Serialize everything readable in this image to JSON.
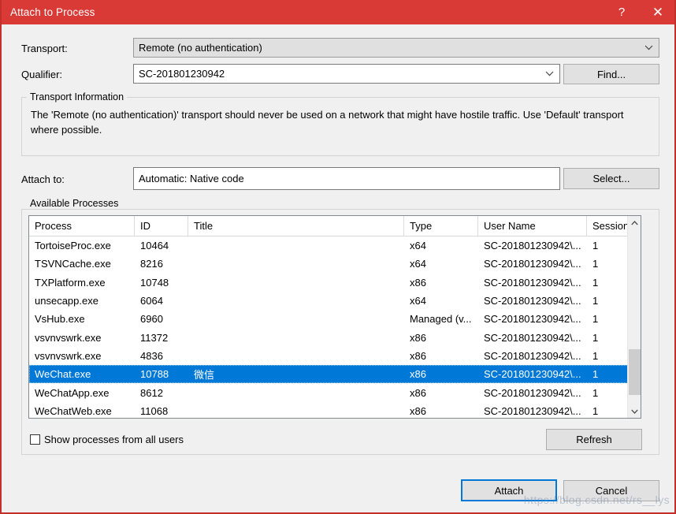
{
  "window": {
    "title": "Attach to Process",
    "help_glyph": "?",
    "close_glyph": "✕",
    "titlebar_color": "#d93a35"
  },
  "form": {
    "transport_label": "Transport:",
    "transport_value": "Remote (no authentication)",
    "qualifier_label": "Qualifier:",
    "qualifier_value": "SC-201801230942",
    "find_button": "Find...",
    "attach_to_label": "Attach to:",
    "attach_to_value": "Automatic: Native code",
    "select_button": "Select..."
  },
  "transport_info": {
    "title": "Transport Information",
    "text": "The 'Remote (no authentication)' transport should never be used on a network that might have hostile traffic. Use 'Default' transport where possible."
  },
  "available_processes": {
    "title": "Available Processes",
    "columns": [
      "Process",
      "ID",
      "Title",
      "Type",
      "User Name",
      "Session"
    ],
    "rows": [
      {
        "process": "TortoiseProc.exe",
        "id": "10464",
        "title": "",
        "type": "x64",
        "user": "SC-201801230942\\...",
        "session": "1",
        "selected": false
      },
      {
        "process": "TSVNCache.exe",
        "id": "8216",
        "title": "",
        "type": "x64",
        "user": "SC-201801230942\\...",
        "session": "1",
        "selected": false
      },
      {
        "process": "TXPlatform.exe",
        "id": "10748",
        "title": "",
        "type": "x86",
        "user": "SC-201801230942\\...",
        "session": "1",
        "selected": false
      },
      {
        "process": "unsecapp.exe",
        "id": "6064",
        "title": "",
        "type": "x64",
        "user": "SC-201801230942\\...",
        "session": "1",
        "selected": false
      },
      {
        "process": "VsHub.exe",
        "id": "6960",
        "title": "",
        "type": "Managed (v...",
        "user": "SC-201801230942\\...",
        "session": "1",
        "selected": false
      },
      {
        "process": "vsvnvswrk.exe",
        "id": "11372",
        "title": "",
        "type": "x86",
        "user": "SC-201801230942\\...",
        "session": "1",
        "selected": false
      },
      {
        "process": "vsvnvswrk.exe",
        "id": "4836",
        "title": "",
        "type": "x86",
        "user": "SC-201801230942\\...",
        "session": "1",
        "selected": false
      },
      {
        "process": "WeChat.exe",
        "id": "10788",
        "title": "微信",
        "type": "x86",
        "user": "SC-201801230942\\...",
        "session": "1",
        "selected": true
      },
      {
        "process": "WeChatApp.exe",
        "id": "8612",
        "title": "",
        "type": "x86",
        "user": "SC-201801230942\\...",
        "session": "1",
        "selected": false
      },
      {
        "process": "WeChatWeb.exe",
        "id": "11068",
        "title": "",
        "type": "x86",
        "user": "SC-201801230942\\...",
        "session": "1",
        "selected": false
      }
    ],
    "show_all_users_label": "Show processes from all users",
    "show_all_users_checked": false,
    "refresh_button": "Refresh"
  },
  "footer": {
    "attach_button": "Attach",
    "cancel_button": "Cancel"
  },
  "watermark": "https://blog.csdn.net/rs__lys",
  "selection_color": "#0078d7"
}
